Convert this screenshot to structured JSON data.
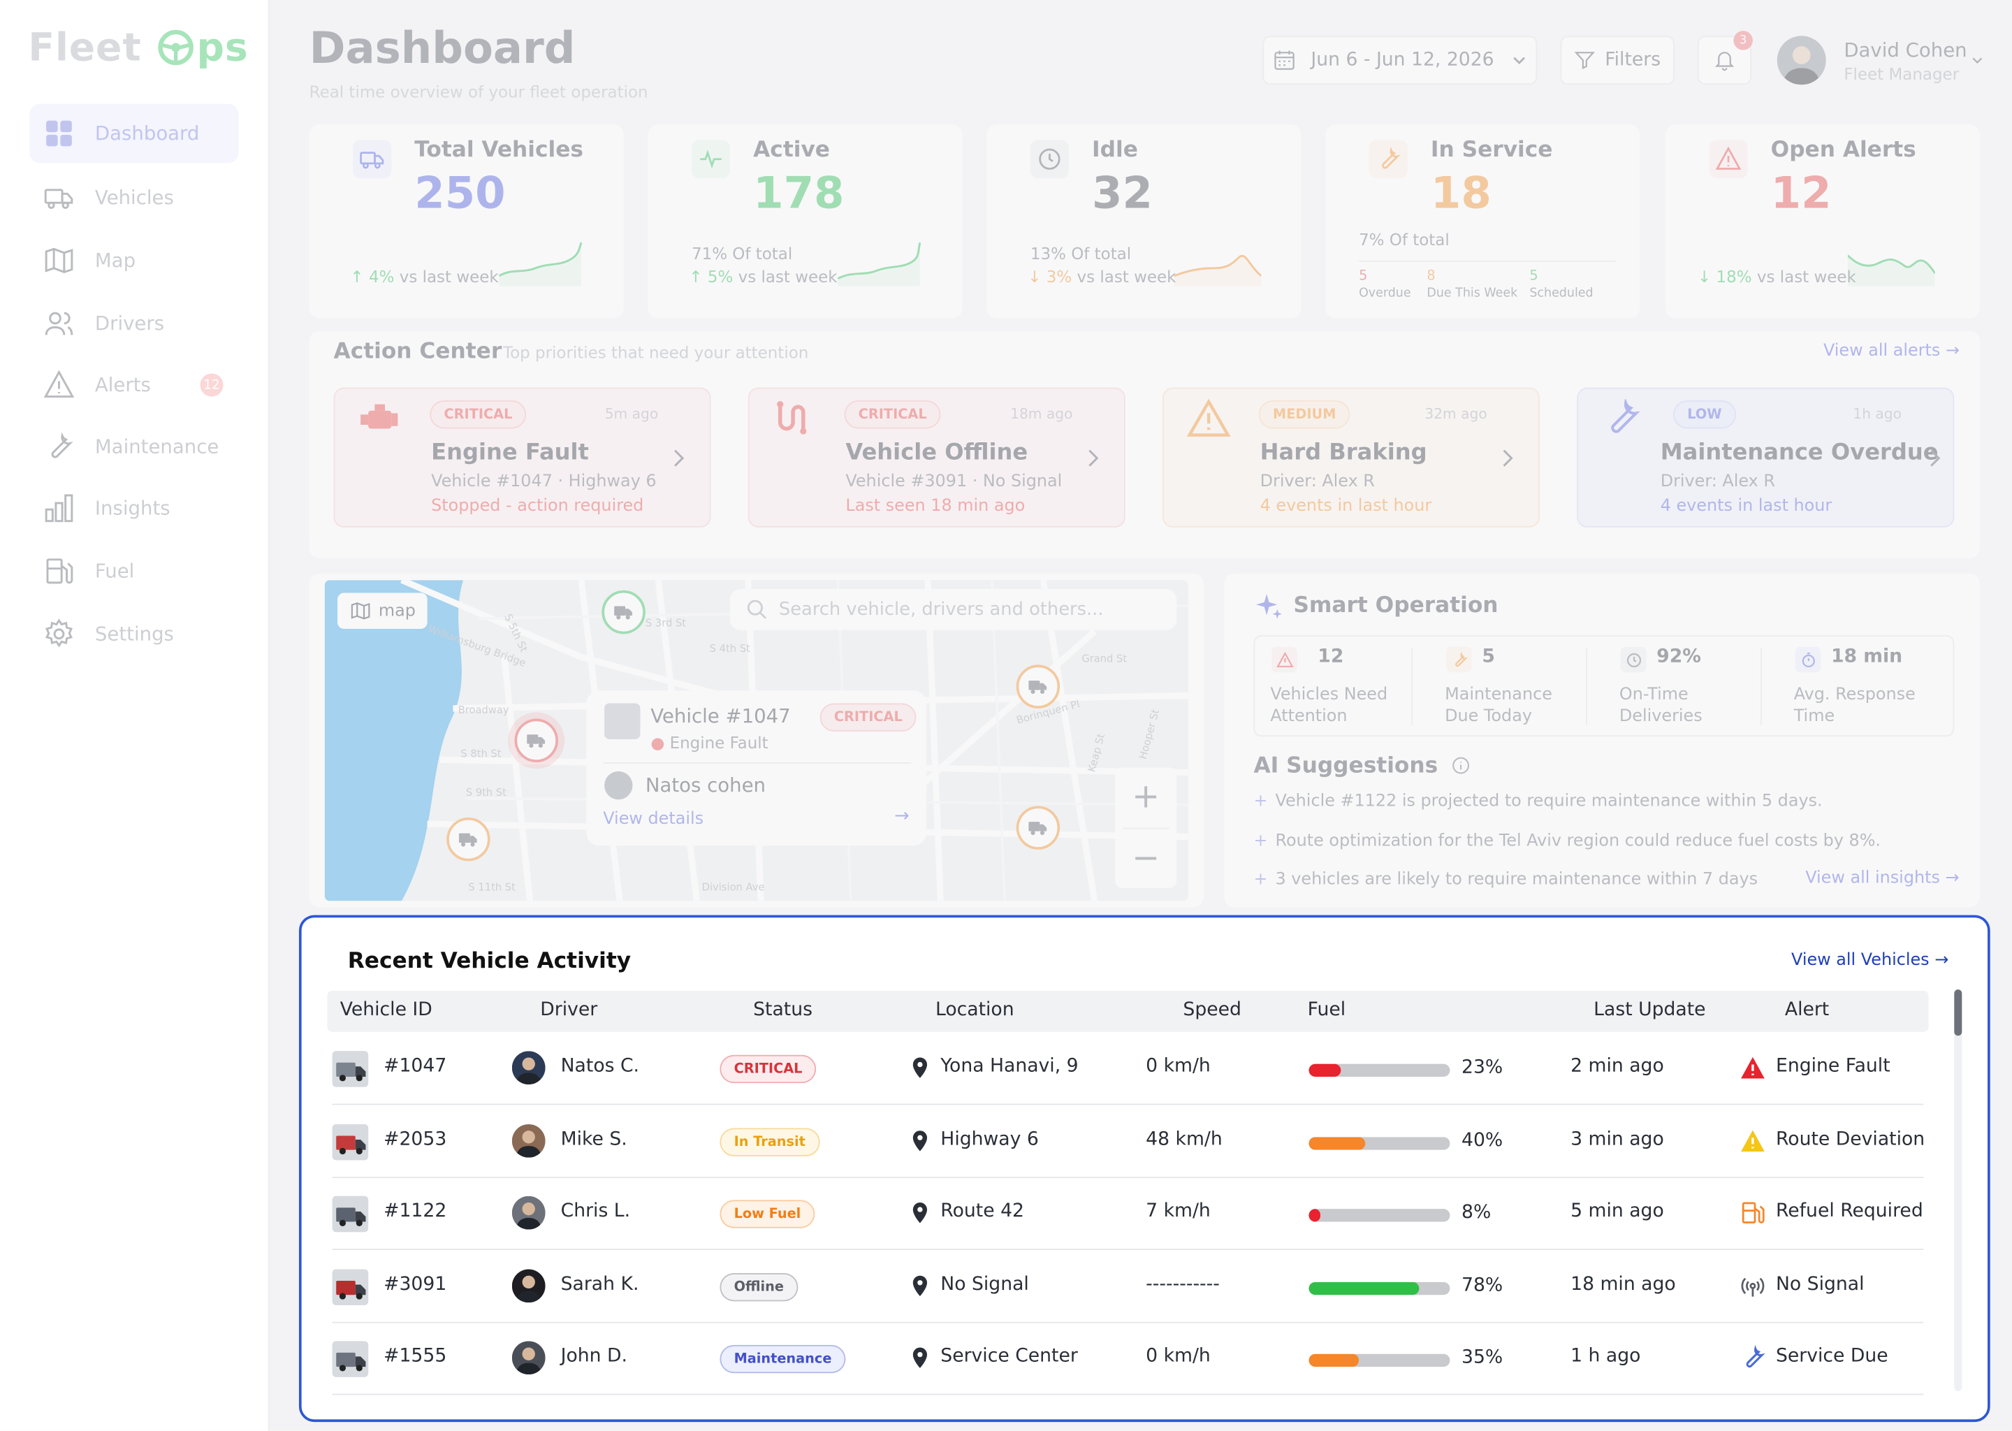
{
  "brand": {
    "logo_prefix": "Fleet",
    "logo_suffix": "ps"
  },
  "nav": [
    {
      "label": "Dashboard",
      "icon": "grid-icon",
      "active": true
    },
    {
      "label": "Vehicles",
      "icon": "truck-icon"
    },
    {
      "label": "Map",
      "icon": "map-icon"
    },
    {
      "label": "Drivers",
      "icon": "users-icon"
    },
    {
      "label": "Alerts",
      "icon": "warning-icon",
      "badge": "12"
    },
    {
      "label": "Maintenance",
      "icon": "wrench-icon"
    },
    {
      "label": "Insights",
      "icon": "bar-chart-icon"
    },
    {
      "label": "Fuel",
      "icon": "fuel-icon"
    },
    {
      "label": "Settings",
      "icon": "gear-icon"
    }
  ],
  "header": {
    "title": "Dashboard",
    "subtitle": "Real time overview of your fleet operation",
    "date_range": "Jun 6 - Jun 12,  2026",
    "filters_label": "Filters",
    "notification_count": "3",
    "user_name": "David Cohen",
    "user_role": "Fleet Manager"
  },
  "stats": [
    {
      "label": "Total Vehicles",
      "value": "250",
      "color": "#4f5fe0",
      "trend_pct": "4%",
      "trend_text": "vs last week",
      "trend_arrow": "↑",
      "trend_color": "#2fbf5a"
    },
    {
      "label": "Active",
      "value": "178",
      "color": "#2fbf5a",
      "sub": "71% Of total",
      "trend_pct": "5%",
      "trend_text": "vs last week",
      "trend_arrow": "↑",
      "trend_color": "#2fbf5a"
    },
    {
      "label": "Idle",
      "value": "32",
      "color": "#4a4e57",
      "sub": "13% Of total",
      "trend_pct": "3%",
      "trend_text": "vs last week",
      "trend_arrow": "↓",
      "trend_color": "#f5902a"
    },
    {
      "label": "In Service",
      "value": "18",
      "color": "#f5902a",
      "sub": "7% Of total",
      "breakdown": [
        {
          "value": "5",
          "label": "Overdue",
          "color": "#e94b4b"
        },
        {
          "value": "8",
          "label": "Due This Week",
          "color": "#f5902a"
        },
        {
          "value": "5",
          "label": "Scheduled",
          "color": "#2fbf5a"
        }
      ]
    },
    {
      "label": "Open Alerts",
      "value": "12",
      "color": "#e94b4b",
      "trend_pct": "18%",
      "trend_text": "vs last week",
      "trend_arrow": "↓",
      "trend_color": "#2fbf5a"
    }
  ],
  "action_center": {
    "title": "Action Center",
    "subtitle": "Top priorities that need your attention",
    "view_all": "View all alerts",
    "cards": [
      {
        "tag": "CRITICAL",
        "ago": "5m ago",
        "title": "Engine Fault",
        "detail": "Vehicle #1047  ·  Highway 6",
        "note": "Stopped - action required",
        "accent": "#e94b4b",
        "bg": "#fdeeee"
      },
      {
        "tag": "CRITICAL",
        "ago": "18m ago",
        "title": "Vehicle Offline",
        "detail": "Vehicle #3091  ·  No Signal",
        "note": "Last seen 18 min ago",
        "accent": "#e94b4b",
        "bg": "#fdeeee"
      },
      {
        "tag": "MEDIUM",
        "ago": "32m ago",
        "title": "Hard Braking",
        "detail": "Driver: Alex R",
        "note": "4 events in last hour",
        "accent": "#f5902a",
        "bg": "#fef4ea"
      },
      {
        "tag": "LOW",
        "ago": "1h ago",
        "title": "Maintenance Overdue",
        "detail": "Driver: Alex R",
        "note": "4 events in last hour",
        "accent": "#5764dd",
        "bg": "#eef0fc"
      }
    ]
  },
  "map": {
    "button_label": "map",
    "search_placeholder": "Search vehicle, drivers and others...",
    "popup": {
      "vehicle": "Vehicle #1047",
      "tag": "CRITICAL",
      "issue": "Engine Fault",
      "driver": "Natos cohen",
      "link": "View details"
    },
    "streets": [
      "Broadway",
      "Williamsburg Bridge",
      "S 5th St",
      "S 8th St",
      "S 9th St",
      "S 11th St",
      "Grand St",
      "Borinquen Pl",
      "Division Ave",
      "Keap St",
      "Hooper St",
      "S 4th St",
      "S 3rd St"
    ]
  },
  "smart": {
    "title": "Smart Operation",
    "kpis": [
      {
        "value": "12",
        "label1": "Vehicles Need",
        "label2": "Attention",
        "color": "#e94b4b"
      },
      {
        "value": "5",
        "label1": "Maintenance",
        "label2": "Due Today",
        "color": "#f5902a"
      },
      {
        "value": "92%",
        "label1": "On-Time",
        "label2": "Deliveries",
        "color": "#6d717a"
      },
      {
        "value": "18 min",
        "label1": "Avg. Response",
        "label2": "Time",
        "color": "#5764dd"
      }
    ],
    "ai_title": "AI Suggestions",
    "suggestions": [
      "Vehicle #1122 is projected to require maintenance within 5 days.",
      "Route optimization for the Tel Aviv region could reduce fuel costs by 8%.",
      "3 vehicles are likely to require maintenance within 7 days"
    ],
    "view_all": "View all insights"
  },
  "activity": {
    "title": "Recent Vehicle Activity",
    "view_all": "View all Vehicles",
    "columns": [
      "Vehicle ID",
      "Driver",
      "Status",
      "Location",
      "Speed",
      "Fuel",
      "Last Update",
      "Alert"
    ],
    "rows": [
      {
        "id": "#1047",
        "driver": "Natos C.",
        "status": "CRITICAL",
        "status_color": "#d8343a",
        "status_bg": "#fdecee",
        "location": "Yona Hanavi, 9",
        "speed": "0 km/h",
        "fuel": 0.23,
        "fuel_label": "23%",
        "fuel_color": "#e8222e",
        "updated": "2 min ago",
        "alert": "Engine Fault",
        "alert_icon": "warning-icon",
        "alert_color": "#e8222e"
      },
      {
        "id": "#2053",
        "driver": "Mike S.",
        "status": "In Transit",
        "status_color": "#e8a20c",
        "status_bg": "#fff7e6",
        "location": "Highway 6",
        "speed": "48 km/h",
        "fuel": 0.4,
        "fuel_label": "40%",
        "fuel_color": "#f5862a",
        "updated": "3 min ago",
        "alert": "Route Deviation",
        "alert_icon": "warning-icon",
        "alert_color": "#f5c518"
      },
      {
        "id": "#1122",
        "driver": "Chris L.",
        "status": "Low Fuel",
        "status_color": "#f07e16",
        "status_bg": "#fff2e6",
        "location": "Route 42",
        "speed": "7 km/h",
        "fuel": 0.08,
        "fuel_label": "8%",
        "fuel_color": "#e8222e",
        "updated": "5 min ago",
        "alert": "Refuel Required",
        "alert_icon": "fuel-icon",
        "alert_color": "#f5862a"
      },
      {
        "id": "#3091",
        "driver": "Sarah K.",
        "status": "Offline",
        "status_color": "#5b5e67",
        "status_bg": "#f3f3f5",
        "location": "No Signal",
        "speed": "-----------",
        "fuel": 0.78,
        "fuel_label": "78%",
        "fuel_color": "#2fbf46",
        "updated": "18 min ago",
        "alert": "No Signal",
        "alert_icon": "signal-icon",
        "alert_color": "#5b5e67"
      },
      {
        "id": "#1555",
        "driver": "John D.",
        "status": "Maintenance",
        "status_color": "#4350c9",
        "status_bg": "#eceffd",
        "location": "Service Center",
        "speed": "0 km/h",
        "fuel": 0.35,
        "fuel_label": "35%",
        "fuel_color": "#f5862a",
        "updated": "1 h ago",
        "alert": "Service Due",
        "alert_icon": "wrench-icon",
        "alert_color": "#4a6bd8"
      }
    ]
  }
}
